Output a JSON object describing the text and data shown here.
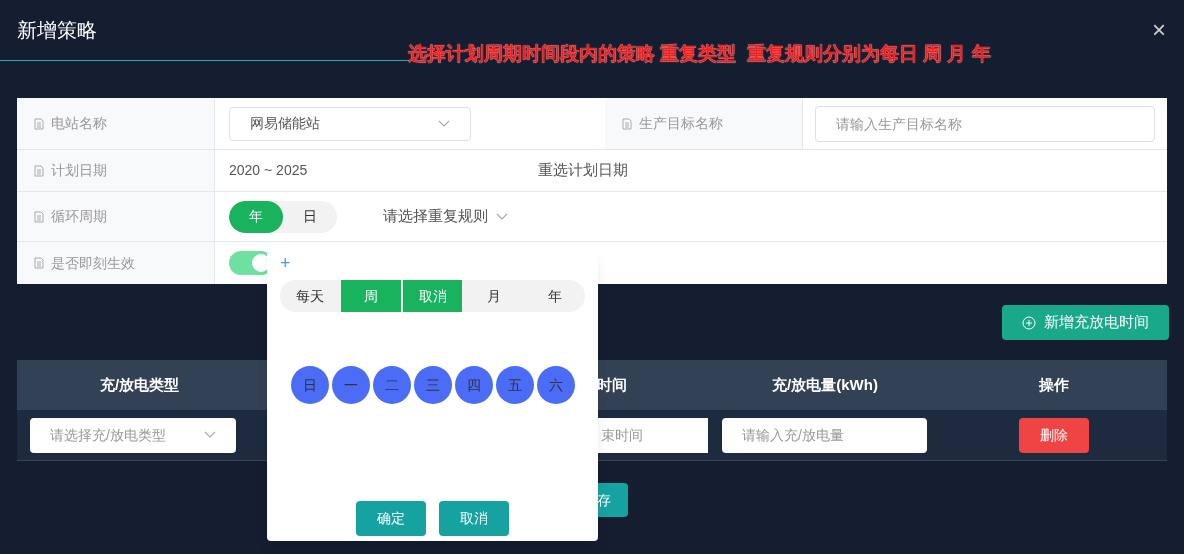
{
  "dialog": {
    "title": "新增策略",
    "close": "×"
  },
  "annotation": "选择计划周期时间段内的策略 重复类型  重复规则分别为每日 周 月 年",
  "form": {
    "station_label": "电站名称",
    "station_value": "网易储能站",
    "target_label": "生产目标名称",
    "target_placeholder": "请输入生产目标名称",
    "date_label": "计划日期",
    "date_value": "2020 ~ 2025",
    "reselect": "重选计划日期",
    "cycle_label": "循环周期",
    "cycle_options": [
      {
        "label": "年",
        "selected": true
      },
      {
        "label": "日",
        "selected": false
      }
    ],
    "repeat_rule": "请选择重复规则",
    "effective_label": "是否即刻生效",
    "effective_on": true
  },
  "add_button": "新增充放电时间",
  "table": {
    "columns": [
      "充/放电类型",
      "时间",
      "充/放电量(kWh)",
      "操作"
    ],
    "row": {
      "type_placeholder": "请选择充/放电类型",
      "end_placeholder": "束时间",
      "amount_placeholder": "请输入充/放电量",
      "delete": "删除"
    }
  },
  "save_button": "存",
  "popover": {
    "add": "+",
    "tabs": [
      {
        "label": "每天",
        "selected": false
      },
      {
        "label": "周",
        "selected": true
      },
      {
        "label": "取消",
        "selected": true
      },
      {
        "label": "月",
        "selected": false
      },
      {
        "label": "年",
        "selected": false
      }
    ],
    "weekdays": [
      "日",
      "一",
      "二",
      "三",
      "四",
      "五",
      "六"
    ],
    "confirm": "确定",
    "cancel": "取消"
  }
}
